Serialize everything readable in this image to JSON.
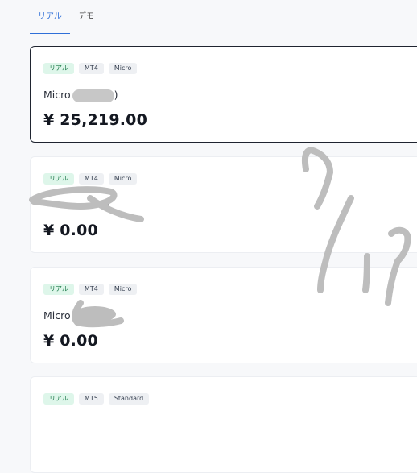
{
  "tabs": [
    {
      "label": "リアル",
      "active": true
    },
    {
      "label": "デモ",
      "active": false
    }
  ],
  "accounts": [
    {
      "badges": [
        "リアル",
        "MT4",
        "Micro"
      ],
      "name": "Micro",
      "name_suffix": ")",
      "balance": "¥ 25,219.00",
      "selected": true
    },
    {
      "badges": [
        "リアル",
        "MT4",
        "Micro"
      ],
      "name": "",
      "name_suffix": ")",
      "balance": "¥ 0.00",
      "selected": false
    },
    {
      "badges": [
        "リアル",
        "MT4",
        "Micro"
      ],
      "name": "Micro",
      "name_suffix": "",
      "balance": "¥ 0.00",
      "selected": false
    },
    {
      "badges": [
        "リアル",
        "MT5",
        "Standard"
      ],
      "name": "",
      "name_suffix": "",
      "balance": "",
      "selected": false
    }
  ],
  "colors": {
    "accent": "#2f6fd8",
    "real_badge_bg": "#def6ea",
    "real_badge_text": "#1e7a4a",
    "scribble": "#bdbdbd"
  }
}
